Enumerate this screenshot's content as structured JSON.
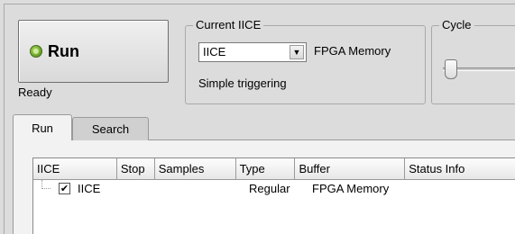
{
  "run_panel": {
    "run_label": "Run",
    "run_icon": "green-circle-icon",
    "status": "Ready"
  },
  "current_iice": {
    "title": "Current IICE",
    "selected": "IICE",
    "memory_label": "FPGA Memory",
    "triggering": "Simple triggering"
  },
  "cycle": {
    "title": "Cycle"
  },
  "tabs": [
    {
      "label": "Run",
      "active": true
    },
    {
      "label": "Search",
      "active": false
    }
  ],
  "table": {
    "columns": [
      "IICE",
      "Stop",
      "Samples",
      "Type",
      "Buffer",
      "Status Info"
    ],
    "rows": [
      {
        "name": "IICE",
        "checked": true,
        "stop": "",
        "samples": "",
        "type": "Regular",
        "buffer": "FPGA Memory",
        "status": ""
      }
    ]
  }
}
